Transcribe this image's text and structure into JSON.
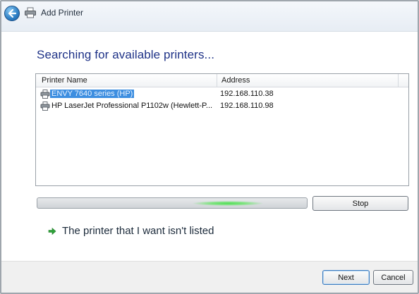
{
  "window": {
    "title": "Add Printer"
  },
  "heading": "Searching for available printers...",
  "list": {
    "columns": [
      "Printer Name",
      "Address"
    ],
    "rows": [
      {
        "name": "ENVY 7640 series (HP)",
        "address": "192.168.110.38",
        "selected": true,
        "icon": "printer-icon"
      },
      {
        "name": "HP LaserJet Professional P1102w (Hewlett-P...",
        "address": "192.168.110.98",
        "selected": false,
        "icon": "printer-icon"
      }
    ]
  },
  "progress": {
    "state": "searching (indeterminate)"
  },
  "buttons": {
    "stop": "Stop",
    "next": "Next",
    "cancel": "Cancel"
  },
  "link": {
    "not_listed": "The printer that I want isn't listed",
    "icon": "green-arrow-icon"
  },
  "colors": {
    "heading": "#1e3287",
    "selection": "#3d8ee0",
    "progress_glow": "#4fdd55"
  }
}
